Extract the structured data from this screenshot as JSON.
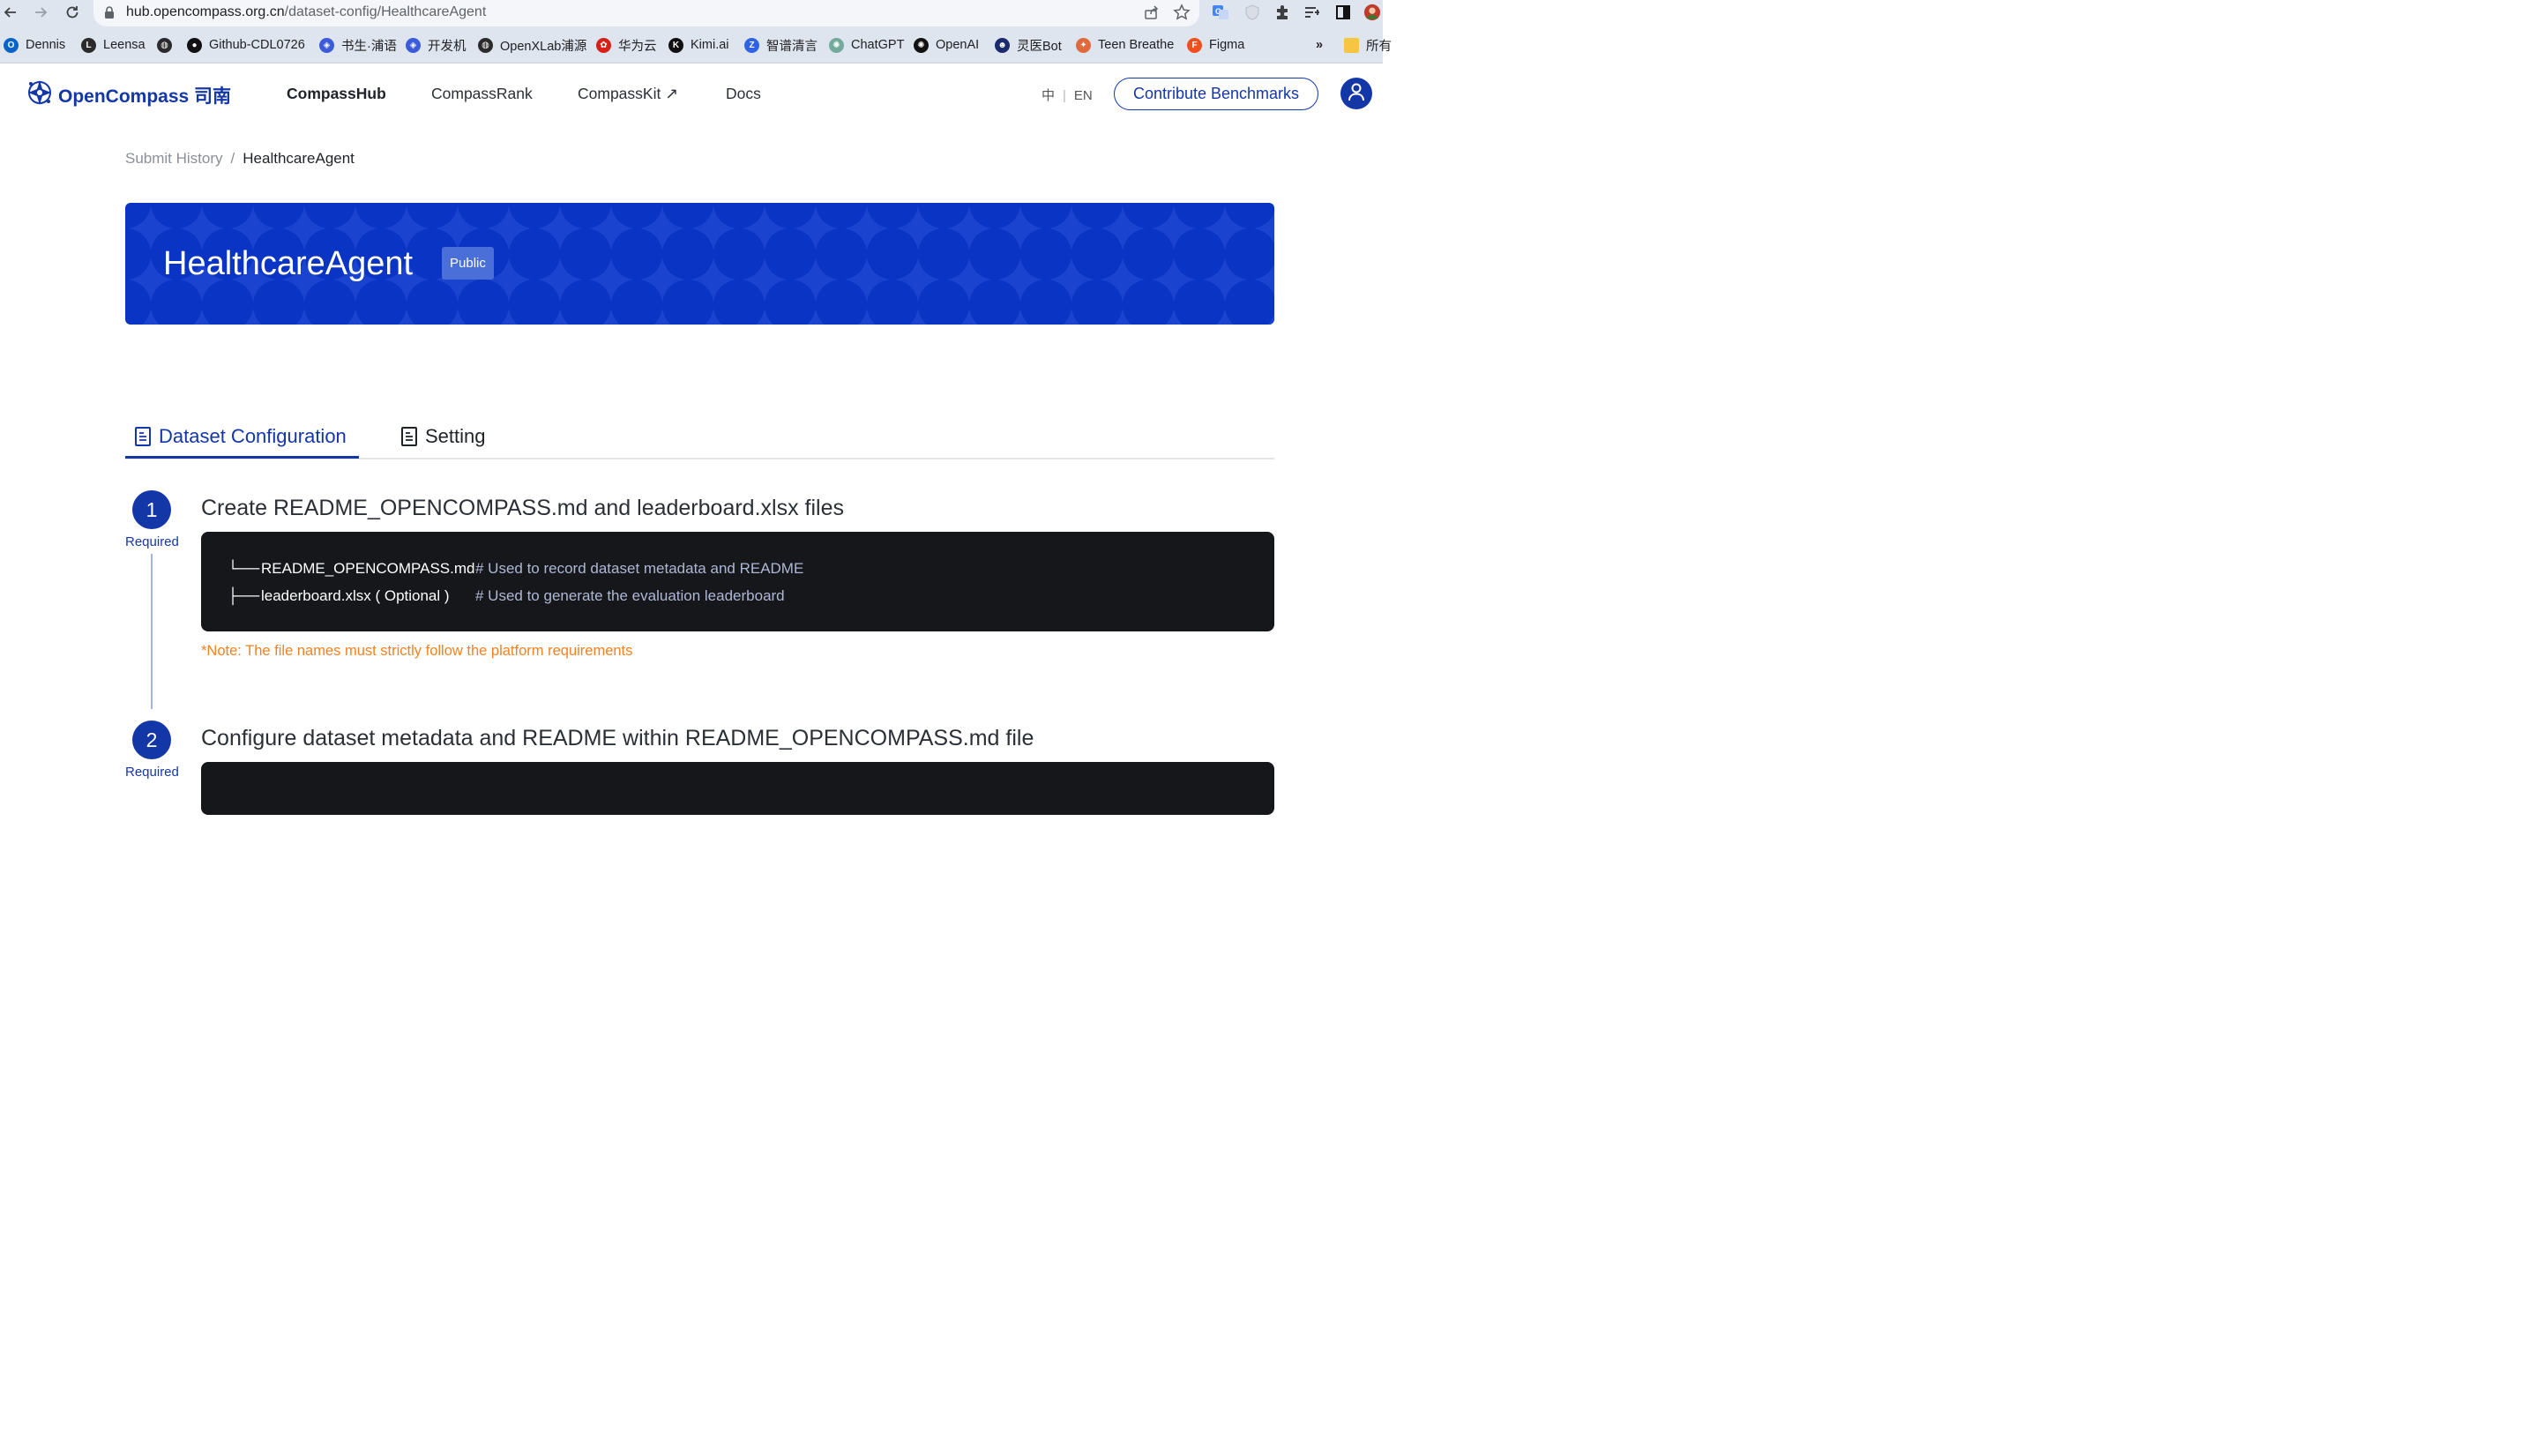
{
  "browser": {
    "url_host": "hub.opencompass.org.cn",
    "url_path": "/dataset-config/HealthcareAgent"
  },
  "bookmarks": [
    {
      "label": "Dennis",
      "icon": "outlook-icon",
      "color": "#0a64c8"
    },
    {
      "label": "Leensa",
      "icon": "leensa-icon",
      "color": "#2b2b2b"
    },
    {
      "label": "",
      "icon": "globe-icon",
      "color": "#2b2b2b"
    },
    {
      "label": "Github-CDL0726",
      "icon": "github-icon",
      "color": "#111111"
    },
    {
      "label": "书生·浦语",
      "icon": "internlm-icon",
      "color": "#3b5bdb"
    },
    {
      "label": "开发机",
      "icon": "internlm-icon",
      "color": "#3b5bdb"
    },
    {
      "label": "OpenXLab浦源",
      "icon": "globe-icon",
      "color": "#2b2b2b"
    },
    {
      "label": "华为云",
      "icon": "huawei-icon",
      "color": "#d7201a"
    },
    {
      "label": "Kimi.ai",
      "icon": "kimi-icon",
      "color": "#111111"
    },
    {
      "label": "智谱清言",
      "icon": "zhipu-icon",
      "color": "#2f62e6"
    },
    {
      "label": "ChatGPT",
      "icon": "chatgpt-icon",
      "color": "#74aa9c"
    },
    {
      "label": "OpenAI",
      "icon": "openai-icon",
      "color": "#111111"
    },
    {
      "label": "灵医Bot",
      "icon": "bot-icon",
      "color": "#1a2a6c"
    },
    {
      "label": "Teen Breathe",
      "icon": "teen-breathe-icon",
      "color": "#e06a3c"
    },
    {
      "label": "Figma",
      "icon": "figma-icon",
      "color": "#f24e1e"
    }
  ],
  "bookmarks_overflow": "»",
  "bookmarks_folder": "所有",
  "site": {
    "logo_text": "OpenCompass 司南",
    "nav": [
      "CompassHub",
      "CompassRank",
      "CompassKit ↗",
      "Docs"
    ],
    "active_nav": "CompassHub",
    "lang_zh": "中",
    "lang_en": "EN",
    "contribute_label": "Contribute Benchmarks",
    "brand_color": "#1437a8"
  },
  "breadcrumb": {
    "parent": "Submit History",
    "separator": "/",
    "current": "HealthcareAgent"
  },
  "banner": {
    "title": "HealthcareAgent",
    "badge": "Public",
    "color": "#0a35c4"
  },
  "tabs": [
    {
      "label": "Dataset Configuration",
      "active": true
    },
    {
      "label": "Setting",
      "active": false
    }
  ],
  "steps": [
    {
      "number": "1",
      "required": "Required",
      "title": "Create README_OPENCOMPASS.md and leaderboard.xlsx files",
      "code": [
        {
          "tree": "└──",
          "file": "README_OPENCOMPASS.md",
          "comment": "# Used to record dataset metadata and README"
        },
        {
          "tree": "├──",
          "file": "leaderboard.xlsx ( Optional )",
          "comment": "# Used to generate the evaluation leaderboard"
        }
      ],
      "note": "*Note: The file names must strictly follow the platform requirements"
    },
    {
      "number": "2",
      "required": "Required",
      "title": "Configure dataset metadata and README within README_OPENCOMPASS.md file"
    }
  ]
}
